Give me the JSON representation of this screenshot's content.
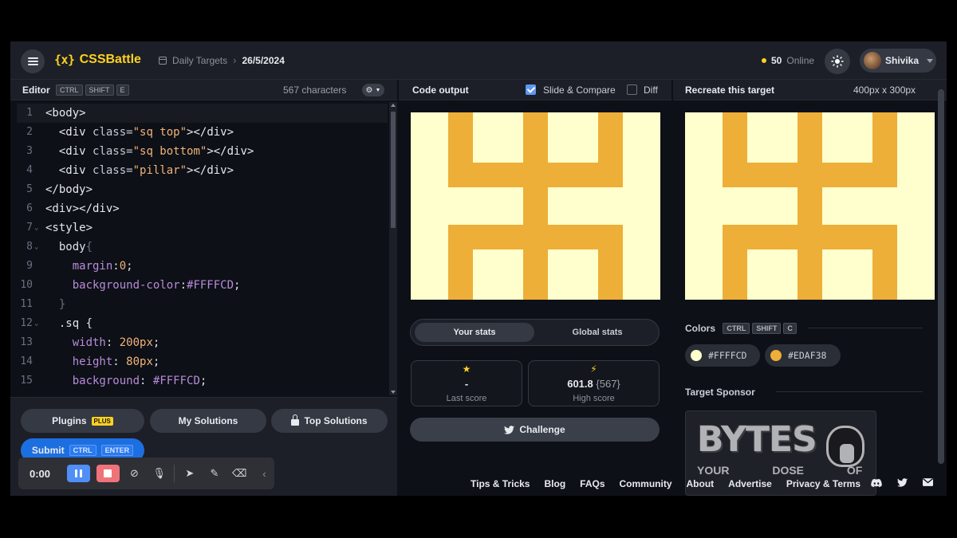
{
  "header": {
    "logo_icon": "{x}",
    "logo_text": "CSSBattle",
    "breadcrumb_section": "Daily Targets",
    "breadcrumb_date": "26/5/2024",
    "online_count": "50",
    "online_label": "Online",
    "user_name": "Shivika"
  },
  "editor": {
    "title": "Editor",
    "shortcut": [
      "CTRL",
      "SHIFT",
      "E"
    ],
    "char_count": "567 characters",
    "line_numbers": [
      "1",
      "2",
      "3",
      "4",
      "5",
      "6",
      "7",
      "8",
      "9",
      "10",
      "11",
      "12",
      "13",
      "14",
      "15"
    ]
  },
  "footer_buttons": {
    "plugins": "Plugins",
    "plugins_badge": "PLUS",
    "my_solutions": "My Solutions",
    "top_solutions": "Top Solutions",
    "submit": "Submit",
    "submit_keys": [
      "CTRL",
      "ENTER"
    ]
  },
  "recorder": {
    "time": "0:00"
  },
  "output": {
    "title": "Code output",
    "slide_compare": "Slide & Compare",
    "slide_compare_checked": true,
    "diff": "Diff",
    "diff_checked": false
  },
  "target": {
    "title": "Recreate this target",
    "size": "400px x 300px",
    "colors_title": "Colors",
    "colors_keys": [
      "CTRL",
      "SHIFT",
      "C"
    ],
    "colors": [
      "#FFFFCD",
      "#EDAF38"
    ],
    "sponsor_title": "Target Sponsor",
    "sponsor_big": "BYTES",
    "sponsor_small": "YOUR DOSE OF"
  },
  "stats": {
    "tab_yours": "Your stats",
    "tab_global": "Global stats",
    "last_score_value": "-",
    "last_score_label": "Last score",
    "high_score_value": "601.8",
    "high_score_chars": "{567}",
    "high_score_label": "High score",
    "challenge": "Challenge"
  },
  "footer_links": [
    "Tips & Tricks",
    "Blog",
    "FAQs",
    "Community",
    "About",
    "Advertise",
    "Privacy & Terms"
  ],
  "icons": {
    "menu": "hamburger-icon",
    "theme": "sun-icon",
    "settings": "gear-icon",
    "twitter": "twitter-icon",
    "discord": "discord-icon",
    "mail": "mail-icon"
  }
}
